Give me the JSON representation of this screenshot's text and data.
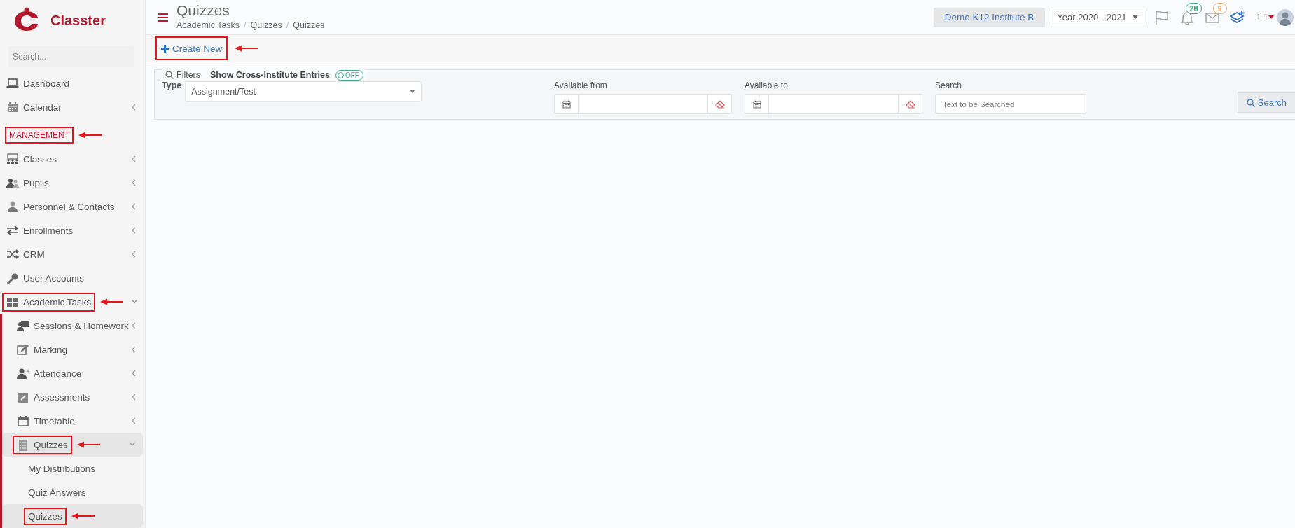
{
  "sidebar": {
    "logo": "Classter",
    "search": {
      "placeholder": "Search..."
    },
    "items": [
      {
        "kind": "link",
        "label": "Dashboard",
        "selected": false,
        "annotated": false
      },
      {
        "kind": "group",
        "label": "Calendar",
        "expanded": false,
        "selected": false,
        "annotated": false
      },
      {
        "kind": "section",
        "label": "MANAGEMENT",
        "annotated": true
      },
      {
        "kind": "group",
        "label": "Classes",
        "expanded": false,
        "selected": false,
        "annotated": false
      },
      {
        "kind": "group",
        "label": "Pupils",
        "expanded": false,
        "selected": false,
        "annotated": false
      },
      {
        "kind": "group",
        "label": "Personnel & Contacts",
        "expanded": false,
        "selected": false,
        "annotated": false
      },
      {
        "kind": "group",
        "label": "Enrollments",
        "expanded": false,
        "selected": false,
        "annotated": false
      },
      {
        "kind": "group",
        "label": "CRM",
        "expanded": false,
        "selected": false,
        "annotated": false
      },
      {
        "kind": "link",
        "label": "User Accounts",
        "selected": false,
        "annotated": false
      },
      {
        "kind": "group",
        "label": "Academic Tasks",
        "expanded": true,
        "selected": false,
        "annotated": true,
        "children": [
          {
            "kind": "group",
            "label": "Sessions & Homework",
            "expanded": false,
            "selected": false,
            "annotated": false
          },
          {
            "kind": "group",
            "label": "Marking",
            "expanded": false,
            "selected": false,
            "annotated": false
          },
          {
            "kind": "group",
            "label": "Attendance",
            "expanded": false,
            "selected": false,
            "annotated": false
          },
          {
            "kind": "group",
            "label": "Assessments",
            "expanded": false,
            "selected": false,
            "annotated": false
          },
          {
            "kind": "group",
            "label": "Timetable",
            "expanded": false,
            "selected": false,
            "annotated": false
          },
          {
            "kind": "group",
            "label": "Quizzes",
            "expanded": true,
            "selected": true,
            "annotated": true,
            "children": [
              {
                "kind": "link",
                "label": "My Distributions",
                "selected": false,
                "annotated": false
              },
              {
                "kind": "link",
                "label": "Quiz Answers",
                "selected": false,
                "annotated": false
              },
              {
                "kind": "link",
                "label": "Quizzes",
                "selected": true,
                "annotated": true
              }
            ]
          }
        ]
      }
    ]
  },
  "header": {
    "title": "Quizzes",
    "breadcrumb": [
      {
        "label": "Academic Tasks"
      },
      {
        "separator": "/",
        "label": "Quizzes"
      },
      {
        "separator": "/",
        "label": "Quizzes"
      }
    ],
    "institute": "Demo K12 Institute B",
    "year": "Year 2020 - 2021",
    "badges": [
      {
        "count": "28",
        "color": "#2fae7e"
      },
      {
        "count": "9",
        "color": "#f2a05a"
      }
    ],
    "user": "1 1"
  },
  "toolbar": {
    "create_button": {
      "label": "Create New",
      "annotated": true
    }
  },
  "filters": {
    "legend": "Filters",
    "cross_institute": {
      "label": "Show Cross-Institute Entries",
      "toggle": "OFF",
      "on": false
    },
    "type": {
      "label": "Type",
      "value": "Assignment/Test"
    },
    "available_from": {
      "label": "Available from"
    },
    "available_to": {
      "label": "Available to"
    },
    "search": {
      "label": "Search",
      "placeholder": "Text to be Searched"
    },
    "search_button": "Search"
  }
}
